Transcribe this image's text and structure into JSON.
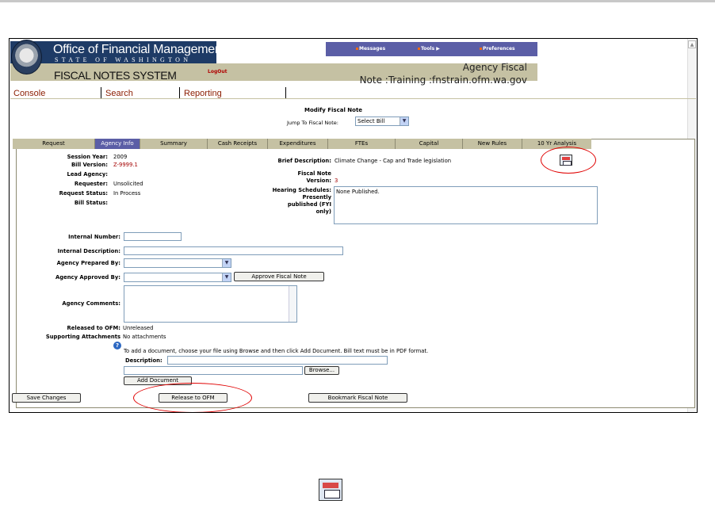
{
  "header": {
    "org_title": "Office of Financial Management",
    "org_subtitle": "STATE OF WASHINGTON",
    "system_title": "FISCAL NOTES SYSTEM",
    "logout": "LogOut",
    "env_line1": "Agency Fiscal",
    "env_line2": "Note :Training :fnstrain.ofm.wa.gov",
    "top_nav": [
      "Messages",
      "Tools",
      "Preferences"
    ]
  },
  "console_nav": [
    "Console",
    "Search",
    "Reporting"
  ],
  "page": {
    "heading": "Modify Fiscal Note",
    "jump_label": "Jump To Fiscal Note:",
    "jump_value": "Select Bill"
  },
  "tabs": [
    "Request",
    "Agency Info",
    "Summary",
    "Cash Receipts",
    "Expenditures",
    "FTEs",
    "Capital",
    "New Rules",
    "10 Yr Analysis"
  ],
  "active_tab": "Agency Info",
  "info": {
    "session_year_label": "Session Year:",
    "session_year": "2009",
    "bill_version_label": "Bill Version:",
    "bill_version": "Z-9999.1",
    "lead_agency_label": "Lead Agency:",
    "requester_label": "Requester:",
    "requester": "Unsolicited",
    "request_status_label": "Request Status:",
    "request_status": "In Process",
    "bill_status_label": "Bill Status:",
    "brief_desc_label": "Brief Description:",
    "brief_desc": "Climate Change - Cap and Trade legislation",
    "fiscal_note_label": "Fiscal Note",
    "version_label": "Version:",
    "version": "3",
    "hearing_label_1": "Hearing Schedules:",
    "hearing_label_2": "Presently",
    "hearing_label_3": "published (FYI",
    "hearing_label_4": "only)",
    "hearing_value": "None Published."
  },
  "form": {
    "internal_number_label": "Internal Number:",
    "internal_desc_label": "Internal Description:",
    "prepared_by_label": "Agency Prepared By:",
    "approved_by_label": "Agency Approved By:",
    "approve_button": "Approve Fiscal Note",
    "comments_label": "Agency Comments:",
    "released_label": "Released to OFM:",
    "released_value": "Unreleased",
    "attachments_label": "Supporting Attachments",
    "attachments_value": "No attachments",
    "help_text": "To add a document, choose your file using Browse and then click Add Document. Bill text must be in PDF format.",
    "description_label": "Description:",
    "browse_button": "Browse...",
    "add_document_button": "Add Document"
  },
  "actions": {
    "save": "Save Changes",
    "release": "Release to OFM",
    "bookmark": "Bookmark Fiscal Note"
  },
  "icons": {
    "report": "report-icon",
    "help": "help-icon",
    "seal": "state-seal-icon"
  },
  "colors": {
    "header_blue": "#1e3b66",
    "nav_purple": "#5b5ea6",
    "band_tan": "#c5c1a3",
    "highlight_red": "#e00000"
  }
}
